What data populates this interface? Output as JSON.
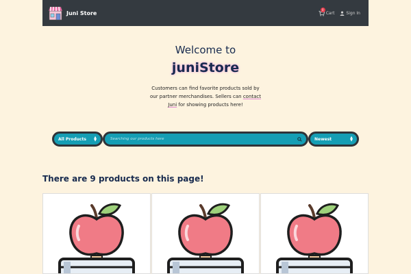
{
  "navbar": {
    "brand": "Juni Store",
    "cart_label": "Cart",
    "cart_count": "0",
    "signin_label": "Sign In",
    "logo_icon": "store-icon",
    "background": "#343a40"
  },
  "hero": {
    "welcome": "Welcome to",
    "store_name": "juniStore",
    "description_part1": "Customers can find favorite products sold by our partner merchandises. Sellers can",
    "contact_link": "contact Juni",
    "description_part2": "for showing products here!"
  },
  "search": {
    "category_selected": "All Products",
    "placeholder": "Searching our products here",
    "sort_selected": "Newest",
    "accent": "#159eb4"
  },
  "products": {
    "count_text": "There are 9 products on this page!",
    "items": [
      {
        "image_icon": "apple-on-books-icon"
      },
      {
        "image_icon": "apple-on-books-icon"
      },
      {
        "image_icon": "apple-on-books-icon"
      }
    ]
  }
}
